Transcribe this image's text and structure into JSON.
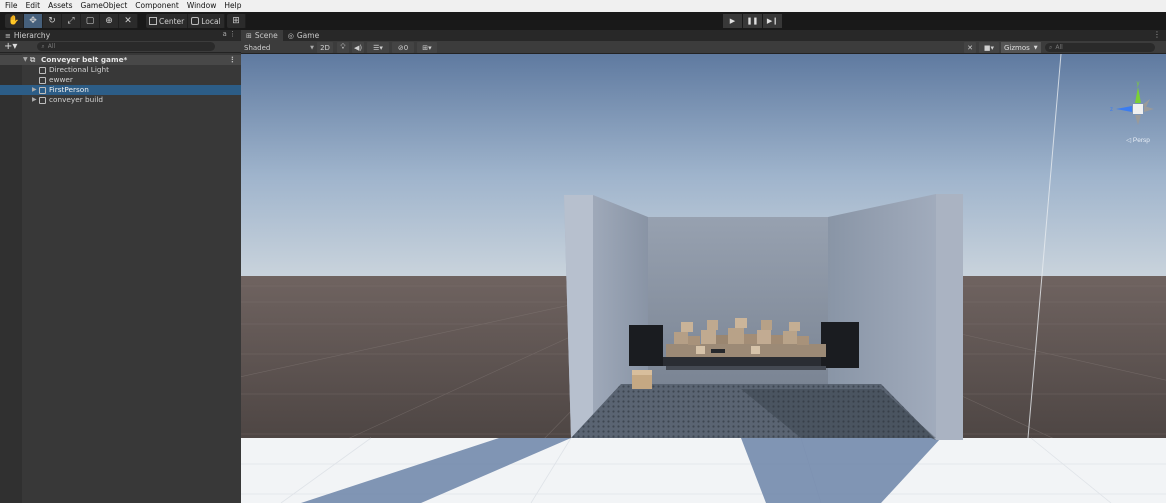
{
  "menu": [
    "File",
    "Edit",
    "Assets",
    "GameObject",
    "Component",
    "Window",
    "Help"
  ],
  "toolbar": {
    "tools": [
      {
        "name": "hand-tool-button",
        "glyph": "✋",
        "active": false
      },
      {
        "name": "move-tool-button",
        "glyph": "✥",
        "active": true
      },
      {
        "name": "rotate-tool-button",
        "glyph": "↻",
        "active": false
      },
      {
        "name": "scale-tool-button",
        "glyph": "⤢",
        "active": false
      },
      {
        "name": "rect-tool-button",
        "glyph": "▢",
        "active": false
      },
      {
        "name": "transform-tool-button",
        "glyph": "⊕",
        "active": false
      },
      {
        "name": "custom-tool-button",
        "glyph": "✕",
        "active": false
      }
    ],
    "pivot_label": "Center",
    "space_label": "Local",
    "play": {
      "play_glyph": "▶",
      "pause_glyph": "❚❚",
      "step_glyph": "▶❙"
    }
  },
  "hierarchy": {
    "tab_label": "Hierarchy",
    "search_placeholder": "All",
    "scene_name": "Conveyer belt game*",
    "items": [
      {
        "label": "Directional Light",
        "has_children": false,
        "selected": false
      },
      {
        "label": "ewwer",
        "has_children": false,
        "selected": false
      },
      {
        "label": "FirstPerson",
        "has_children": true,
        "selected": true
      },
      {
        "label": "conveyer build",
        "has_children": true,
        "selected": false
      }
    ]
  },
  "scene_view": {
    "tabs": [
      {
        "label": "Scene",
        "icon": "grid-icon",
        "active": true
      },
      {
        "label": "Game",
        "icon": "gamepad-icon",
        "active": false
      }
    ],
    "shading_mode": "Shaded",
    "mode_2d_label": "2D",
    "overlay_count": "0",
    "gizmos_label": "Gizmos",
    "search_placeholder": "All",
    "orientation_label": "◁ Persp"
  },
  "colors": {
    "selection": "#2c5d87",
    "active_tool": "#46607c",
    "panel_bg": "#383838",
    "toolbar_bg": "#191919"
  }
}
